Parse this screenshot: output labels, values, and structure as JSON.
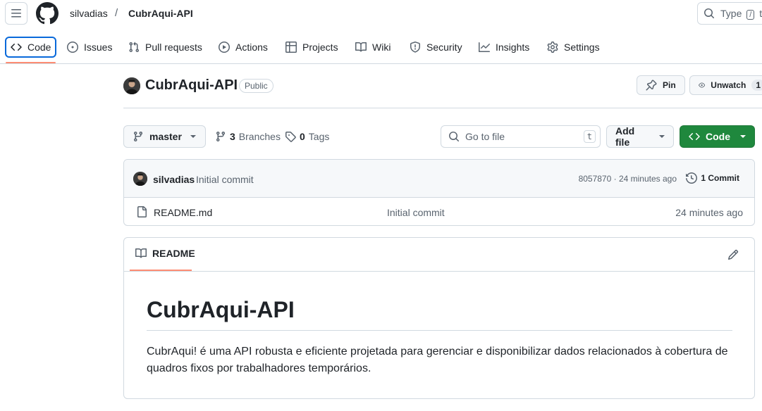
{
  "header": {
    "owner": "silvadias",
    "separator": "/",
    "repo": "CubrAqui-API",
    "search_prefix": "Type",
    "search_key": "/",
    "search_suffix": "to"
  },
  "nav": {
    "items": [
      {
        "label": "Code",
        "icon": "code-icon"
      },
      {
        "label": "Issues",
        "icon": "issue-opened-icon"
      },
      {
        "label": "Pull requests",
        "icon": "git-pull-request-icon"
      },
      {
        "label": "Actions",
        "icon": "play-icon"
      },
      {
        "label": "Projects",
        "icon": "table-icon"
      },
      {
        "label": "Wiki",
        "icon": "book-icon"
      },
      {
        "label": "Security",
        "icon": "shield-icon"
      },
      {
        "label": "Insights",
        "icon": "graph-icon"
      },
      {
        "label": "Settings",
        "icon": "gear-icon"
      }
    ],
    "active": "Code"
  },
  "repo_header": {
    "title": "CubrAqui-API",
    "visibility": "Public",
    "pin_label": "Pin",
    "unwatch_label": "Unwatch",
    "watch_count": "1"
  },
  "file_nav": {
    "branch": "master",
    "branches_count": "3",
    "branches_label": "Branches",
    "tags_count": "0",
    "tags_label": "Tags",
    "goto_placeholder": "Go to file",
    "goto_shortcut": "t",
    "add_file_label": "Add file",
    "code_label": "Code"
  },
  "latest_commit": {
    "author": "silvadias",
    "message": "Initial commit",
    "hash_time": "8057870 · 24 minutes ago",
    "commit_count_label": "1 Commit"
  },
  "files": [
    {
      "name": "README.md",
      "message": "Initial commit",
      "time": "24 minutes ago",
      "icon": "file-icon"
    }
  ],
  "readme": {
    "tab_label": "README",
    "heading": "CubrAqui-API",
    "body": "CubrAqui! é uma API robusta e eficiente projetada para gerenciar e disponibilizar dados relacionados à cobertura de quadros fixos por trabalhadores temporários."
  },
  "colors": {
    "accent_blue": "#0969da",
    "underline_orange": "#fd8c73",
    "primary_green": "#1f883d",
    "border": "#d1d9e0",
    "muted_text": "#59636e"
  }
}
